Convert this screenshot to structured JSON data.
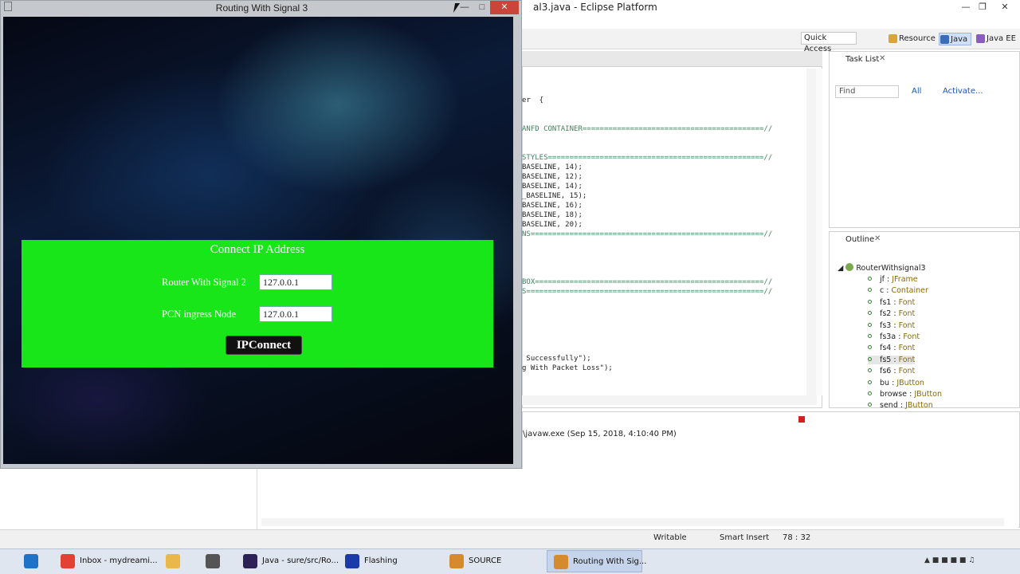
{
  "eclipse": {
    "title": "al3.java - Eclipse Platform",
    "quick_access": "Quick Access",
    "perspectives": [
      "Resource",
      "Java",
      "Java EE"
    ],
    "code_lines": [
      {
        "t": "er  {",
        "cls": ""
      },
      {
        "t": "ANFD CONTAINER==========================================//",
        "cls": "cm"
      },
      {
        "t": "STYLES==================================================//",
        "cls": "cm"
      },
      {
        "t": "BASELINE, 14);",
        "cls": ""
      },
      {
        "t": "BASELINE, 12);",
        "cls": ""
      },
      {
        "t": "BASELINE, 14);",
        "cls": ""
      },
      {
        "t": "_BASELINE, 15);",
        "cls": ""
      },
      {
        "t": "BASELINE, 16);",
        "cls": ""
      },
      {
        "t": "BASELINE, 18);",
        "cls": ""
      },
      {
        "t": "BASELINE, 20);",
        "cls": ""
      },
      {
        "t": "NS======================================================//",
        "cls": "cm"
      },
      {
        "t": "BOX=====================================================//",
        "cls": "cm"
      },
      {
        "t": "S=======================================================//",
        "cls": "cm"
      },
      {
        "t": "",
        "cls": ""
      },
      {
        "t": " Successfully\");",
        "cls": ""
      },
      {
        "t": "g With Packet Loss\");",
        "cls": ""
      }
    ],
    "task_list": {
      "tab": "Task List",
      "find_placeholder": "Find",
      "all": "All",
      "activate": "Activate..."
    },
    "outline": {
      "tab": "Outline",
      "root": "RouterWithsignal3",
      "items": [
        {
          "name": "jf",
          "type": "JFrame"
        },
        {
          "name": "c",
          "type": "Container"
        },
        {
          "name": "fs1",
          "type": "Font"
        },
        {
          "name": "fs2",
          "type": "Font"
        },
        {
          "name": "fs3",
          "type": "Font"
        },
        {
          "name": "fs3a",
          "type": "Font"
        },
        {
          "name": "fs4",
          "type": "Font"
        },
        {
          "name": "fs5",
          "type": "Font"
        },
        {
          "name": "fs6",
          "type": "Font"
        },
        {
          "name": "bu",
          "type": "JButton"
        },
        {
          "name": "browse",
          "type": "JButton"
        },
        {
          "name": "send",
          "type": "JButton"
        }
      ]
    },
    "console_line": "\\javaw.exe (Sep 15, 2018, 4:10:40 PM)",
    "status": {
      "writable": "Writable",
      "insert": "Smart Insert",
      "pos": "78 : 32"
    }
  },
  "app": {
    "title": "Routing With Signal 3",
    "card_title": "Connect IP Address",
    "router_label": "Router With Signal 2",
    "router_value": "127.0.0.1",
    "pcn_label": "PCN ingress Node",
    "pcn_value": "127.0.0.1",
    "connect_label": "IPConnect"
  },
  "taskbar": [
    {
      "label": "",
      "icon": "ie-icon",
      "color": "#1e73c8"
    },
    {
      "label": "Inbox - mydreami...",
      "icon": "chrome-icon",
      "color": "#e34133"
    },
    {
      "label": "",
      "icon": "folder-icon",
      "color": "#e8b84a"
    },
    {
      "label": "",
      "icon": "tool-icon",
      "color": "#555"
    },
    {
      "label": "Java - sure/src/Ro...",
      "icon": "eclipse-icon",
      "color": "#2c2255"
    },
    {
      "label": "Flashing",
      "icon": "app-icon",
      "color": "#1b3ca8"
    },
    {
      "label": "SOURCE",
      "icon": "java-icon",
      "color": "#d68a2e"
    },
    {
      "label": "Routing With Sig...",
      "icon": "java-icon",
      "color": "#d68a2e"
    }
  ]
}
